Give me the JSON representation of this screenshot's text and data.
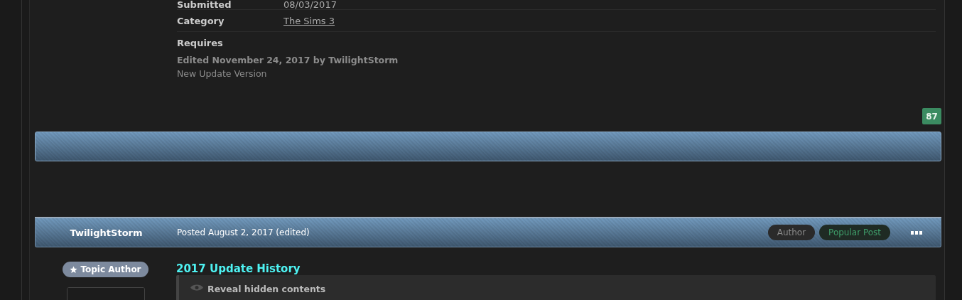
{
  "details": [
    {
      "label": "Submitted",
      "value": "08/03/2017",
      "kind": "text"
    },
    {
      "label": "Category",
      "value": "The Sims 3",
      "kind": "link"
    },
    {
      "label": "Requires"
    }
  ],
  "edit_note": {
    "title": "Edited November 24, 2017 by TwilightStorm",
    "reason": "New Update Version"
  },
  "reputation": "87",
  "post": {
    "author": "TwilightStorm",
    "posted": "Posted August 2, 2017 (edited)",
    "badges": [
      {
        "label": "Author",
        "kind": "author"
      },
      {
        "label": "Popular Post",
        "kind": "popular"
      }
    ],
    "author_badge": "Topic Author",
    "title": "2017 Update History",
    "spoiler": "Reveal hidden contents"
  }
}
